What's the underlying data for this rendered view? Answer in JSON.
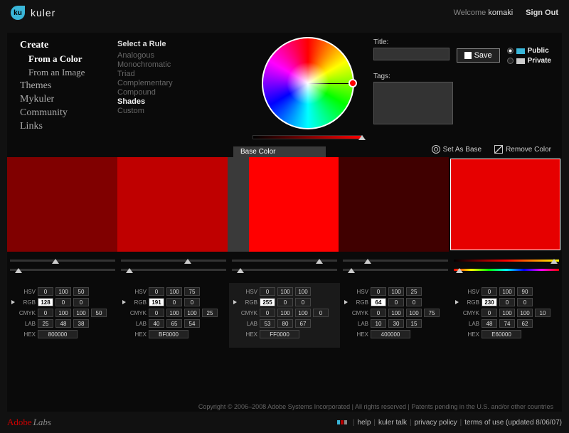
{
  "brand": "kuler",
  "logo_text": "ku",
  "welcome": "Welcome",
  "username": "komaki",
  "signout": "Sign Out",
  "nav": {
    "create": "Create",
    "from_color": "From a Color",
    "from_image": "From an Image",
    "themes": "Themes",
    "mykuler": "Mykuler",
    "community": "Community",
    "links": "Links"
  },
  "rules": {
    "title": "Select a Rule",
    "items": [
      "Analogous",
      "Monochromatic",
      "Triad",
      "Complementary",
      "Compound",
      "Shades",
      "Custom"
    ],
    "active": "Shades"
  },
  "meta": {
    "title_label": "Title:",
    "title_value": "",
    "tags_label": "Tags:",
    "save_label": "Save",
    "public_label": "Public",
    "private_label": "Private",
    "visibility": "public"
  },
  "swatch_actions": {
    "set_base": "Set As Base",
    "remove": "Remove Color"
  },
  "base_tab": "Base Color",
  "colors": [
    {
      "hex": "800000",
      "rgb": [
        128,
        0,
        0
      ],
      "hsv": [
        0,
        100,
        50
      ],
      "cmyk": [
        0,
        100,
        100,
        50
      ],
      "lab": [
        25,
        48,
        38
      ]
    },
    {
      "hex": "BF0000",
      "rgb": [
        191,
        0,
        0
      ],
      "hsv": [
        0,
        100,
        75
      ],
      "cmyk": [
        0,
        100,
        100,
        25
      ],
      "lab": [
        40,
        65,
        54
      ]
    },
    {
      "hex": "FF0000",
      "rgb": [
        255,
        0,
        0
      ],
      "hsv": [
        0,
        100,
        100
      ],
      "cmyk": [
        0,
        100,
        100,
        0
      ],
      "lab": [
        53,
        80,
        67
      ]
    },
    {
      "hex": "400000",
      "rgb": [
        64,
        0,
        0
      ],
      "hsv": [
        0,
        100,
        25
      ],
      "cmyk": [
        0,
        100,
        100,
        75
      ],
      "lab": [
        10,
        30,
        15
      ]
    },
    {
      "hex": "E60000",
      "rgb": [
        230,
        0,
        0
      ],
      "hsv": [
        0,
        100,
        90
      ],
      "cmyk": [
        0,
        100,
        100,
        10
      ],
      "lab": [
        48,
        74,
        62
      ]
    }
  ],
  "labels": {
    "hsv": "HSV",
    "rgb": "RGB",
    "cmyk": "CMYK",
    "lab": "LAB",
    "hex": "HEX"
  },
  "footer": {
    "adobe": "Adobe",
    "labs": "Labs",
    "links": [
      "help",
      "kuler talk",
      "privacy policy",
      "terms of use (updated 8/06/07)"
    ],
    "copyright": "Copyright © 2006–2008 Adobe Systems Incorporated | All rights reserved | Patents pending in the U.S. and/or other countries"
  }
}
